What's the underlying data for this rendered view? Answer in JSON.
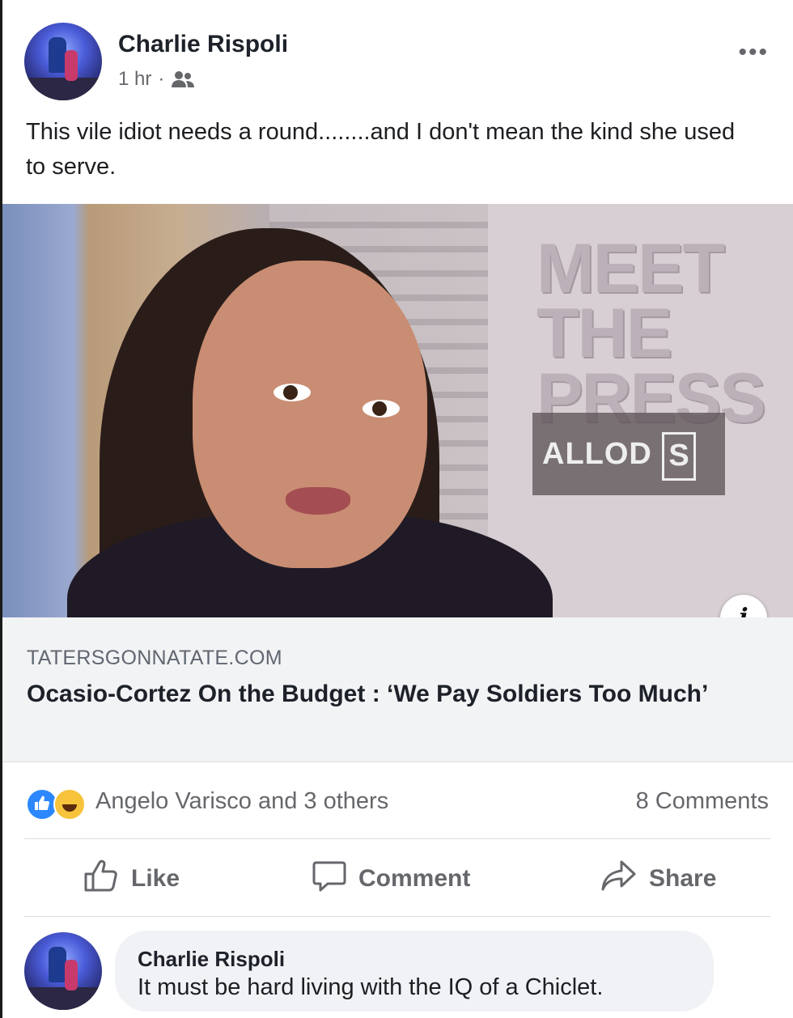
{
  "post": {
    "author": "Charlie Rispoli",
    "time": "1 hr",
    "separator": "·",
    "audience_icon": "friends-icon",
    "more_label": "•••",
    "text": "This vile idiot needs a round........and I don't mean the kind she used to serve."
  },
  "image": {
    "overlay_text": "MEET THE PRESS",
    "watermark": "ALLOD",
    "watermark_box": "S",
    "info_label": "i"
  },
  "link": {
    "domain": "TATERSGONNATATE.COM",
    "title": "Ocasio-Cortez On the Budget : ‘We Pay Soldiers Too Much’"
  },
  "reactions": {
    "icons": [
      "like-reaction-icon",
      "haha-reaction-icon"
    ],
    "names": "Angelo Varisco and 3 others",
    "comments": "8 Comments"
  },
  "actions": {
    "like": "Like",
    "comment": "Comment",
    "share": "Share"
  },
  "comment": {
    "author": "Charlie Rispoli",
    "text": "It must be hard living with the IQ of a Chiclet."
  },
  "colors": {
    "accent": "#2d88ff",
    "muted_text": "#65676b",
    "link_bg": "#f2f3f5",
    "bubble_bg": "#f0f2f5"
  }
}
